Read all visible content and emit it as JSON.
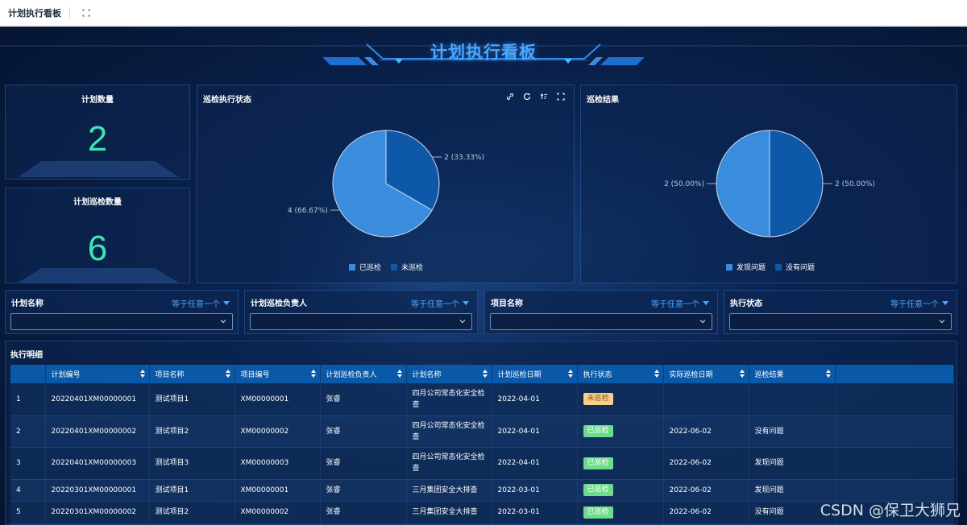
{
  "app": {
    "title": "计划执行看板"
  },
  "dashboard": {
    "title": "计划执行看板"
  },
  "kpis": [
    {
      "label": "计划数量",
      "value": "2"
    },
    {
      "label": "计划巡检数量",
      "value": "6"
    }
  ],
  "charts": {
    "status": {
      "title": "巡检执行状态",
      "label_big": "4 (66.67%)",
      "label_small": "2 (33.33%)",
      "legend": [
        "已巡检",
        "未巡检"
      ]
    },
    "result": {
      "title": "巡检结果",
      "label_left": "2 (50.00%)",
      "label_right": "2 (50.00%)",
      "legend": [
        "发现问题",
        "没有问题"
      ]
    }
  },
  "chart_data": [
    {
      "type": "pie",
      "title": "巡检执行状态",
      "labels": [
        "已巡检",
        "未巡检"
      ],
      "values": [
        4,
        2
      ],
      "percents": [
        66.67,
        33.33
      ],
      "colors": [
        "#3a8ddc",
        "#0d58a8"
      ]
    },
    {
      "type": "pie",
      "title": "巡检结果",
      "labels": [
        "发现问题",
        "没有问题"
      ],
      "values": [
        2,
        2
      ],
      "percents": [
        50.0,
        50.0
      ],
      "colors": [
        "#3a8ddc",
        "#0d58a8"
      ]
    }
  ],
  "filters": [
    {
      "label": "计划名称",
      "op": "等于任意一个"
    },
    {
      "label": "计划巡检负责人",
      "op": "等于任意一个"
    },
    {
      "label": "项目名称",
      "op": "等于任意一个"
    },
    {
      "label": "执行状态",
      "op": "等于任意一个"
    }
  ],
  "table": {
    "title": "执行明细",
    "columns": [
      "",
      "计划编号",
      "项目名称",
      "项目编号",
      "计划巡检负责人",
      "计划名称",
      "计划巡检日期",
      "执行状态",
      "实际巡检日期",
      "巡检结果"
    ],
    "rows": [
      {
        "idx": "1",
        "plan_no": "20220401XM00000001",
        "project": "测试项目1",
        "project_no": "XM00000001",
        "owner": "张睿",
        "plan_name": "四月公司常态化安全检查",
        "plan_date": "2022-04-01",
        "status": "未巡检",
        "actual_date": "",
        "result": ""
      },
      {
        "idx": "2",
        "plan_no": "20220401XM00000002",
        "project": "测试项目2",
        "project_no": "XM00000002",
        "owner": "张睿",
        "plan_name": "四月公司常态化安全检查",
        "plan_date": "2022-04-01",
        "status": "已巡检",
        "actual_date": "2022-06-02",
        "result": "没有问题"
      },
      {
        "idx": "3",
        "plan_no": "20220401XM00000003",
        "project": "测试项目3",
        "project_no": "XM00000003",
        "owner": "张睿",
        "plan_name": "四月公司常态化安全检查",
        "plan_date": "2022-04-01",
        "status": "已巡检",
        "actual_date": "2022-06-02",
        "result": "发现问题"
      },
      {
        "idx": "4",
        "plan_no": "20220301XM00000001",
        "project": "测试项目1",
        "project_no": "XM00000001",
        "owner": "张睿",
        "plan_name": "三月集团安全大排查",
        "plan_date": "2022-03-01",
        "status": "已巡检",
        "actual_date": "2022-06-02",
        "result": "发现问题"
      },
      {
        "idx": "5",
        "plan_no": "20220301XM00000002",
        "project": "测试项目2",
        "project_no": "XM00000002",
        "owner": "张睿",
        "plan_name": "三月集团安全大排查",
        "plan_date": "2022-03-01",
        "status": "已巡检",
        "actual_date": "2022-06-02",
        "result": "没有问题"
      }
    ]
  },
  "status_colors": {
    "未巡检": "#f7d08a",
    "已巡检": "#6fdc8c"
  },
  "watermark": "CSDN @保卫大狮兄"
}
